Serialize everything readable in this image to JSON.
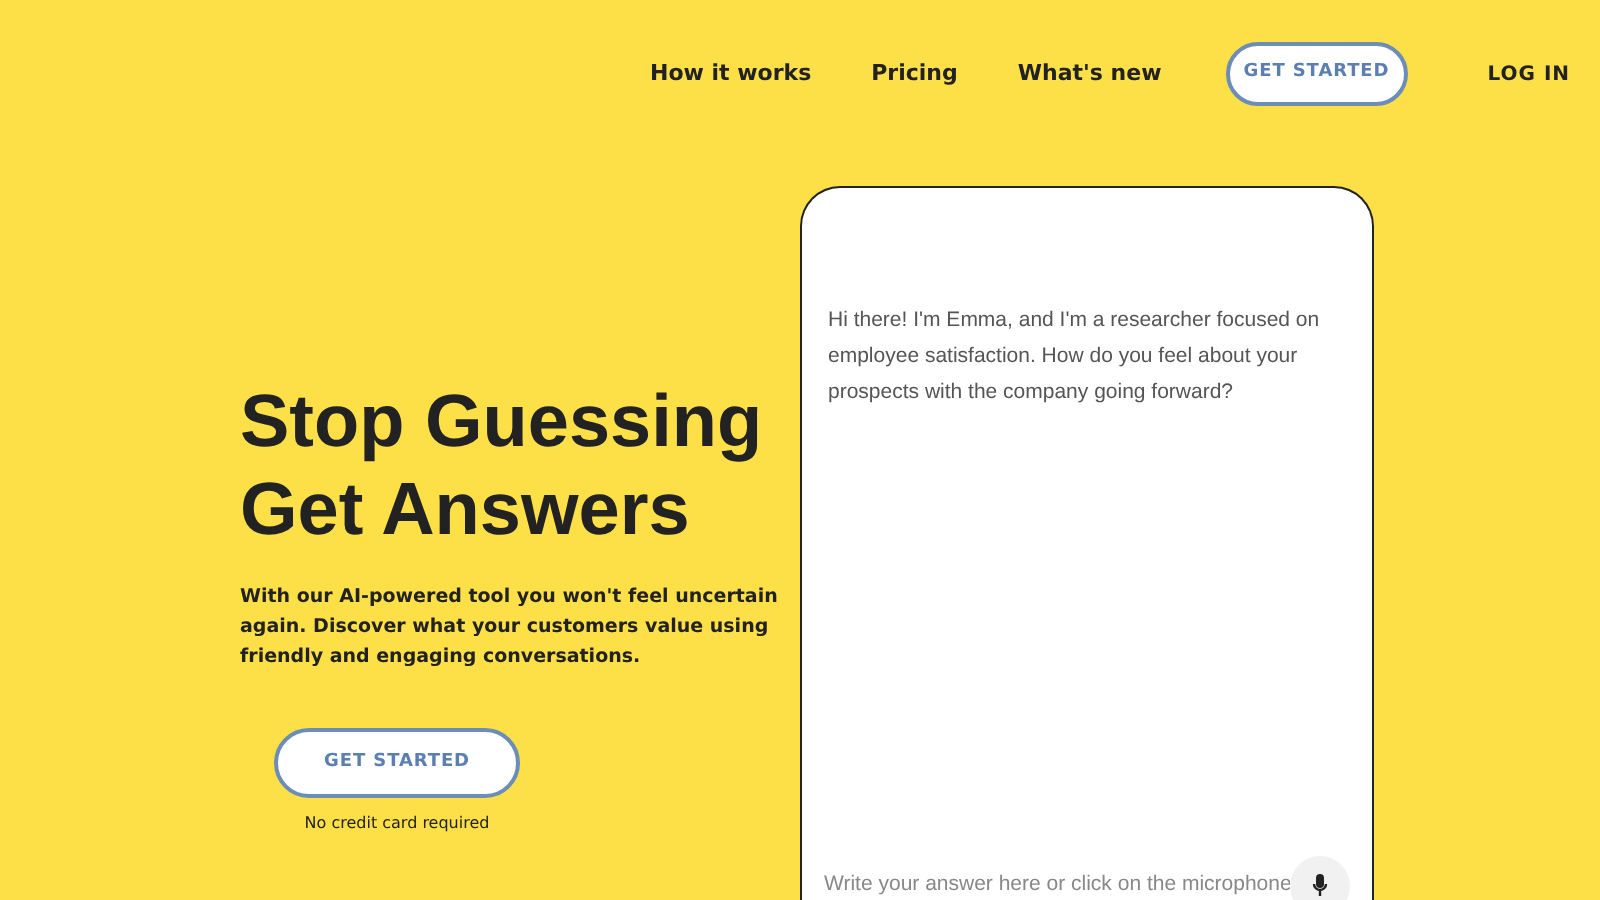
{
  "nav": {
    "links": [
      "How it works",
      "Pricing",
      "What's new"
    ],
    "cta": "GET STARTED",
    "login": "LOG IN"
  },
  "hero": {
    "title_lines": [
      "Stop Guessing",
      "Get Answers"
    ],
    "description": "With our AI-powered tool you won't feel uncertain again. Discover what your customers value using friendly and engaging conversations.",
    "cta": "GET STARTED",
    "note": "No credit card required"
  },
  "chat": {
    "message": "Hi there! I'm Emma, and I'm a researcher focused on employee satisfaction. How do you feel about your prospects with the company going forward?",
    "input": {
      "placeholder": "Write your answer here or click on the microphone"
    }
  }
}
